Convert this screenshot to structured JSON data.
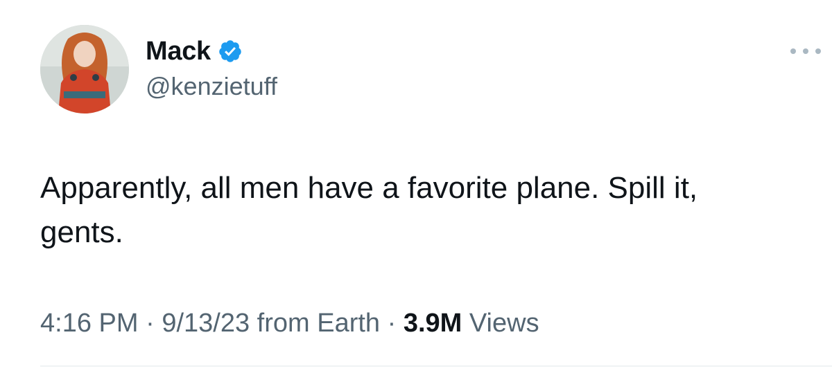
{
  "tweet": {
    "author": {
      "display_name": "Mack",
      "handle": "@kenzietuff",
      "verified": true,
      "avatar_icon": "profile-photo"
    },
    "text": "Apparently, all men have a favorite plane. Spill it,\ngents.",
    "meta": {
      "time": "4:16 PM",
      "separator": "·",
      "date": "9/13/23",
      "location": "from Earth",
      "views_count": "3.9M",
      "views_label": "Views"
    },
    "more_icon": "ellipsis-icon"
  },
  "colors": {
    "text_primary": "#0f1419",
    "text_secondary": "#536471",
    "verified_blue": "#1d9bf0",
    "divider": "#eff3f4"
  }
}
